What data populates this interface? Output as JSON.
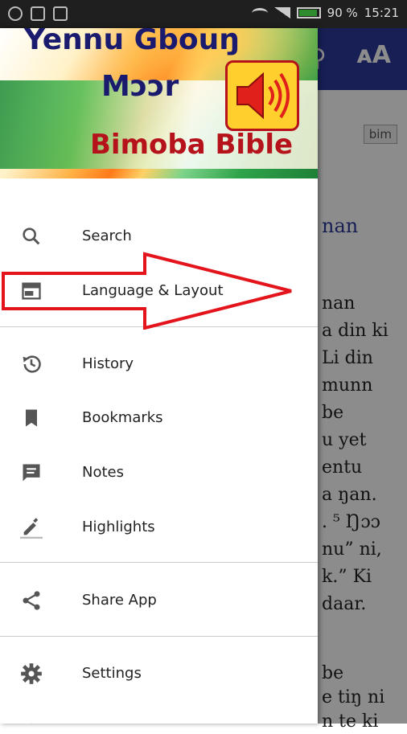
{
  "status_bar": {
    "battery": "90 %",
    "time": "15:21"
  },
  "app": {
    "aa_label": "ᴀA",
    "bim_label": "bim",
    "heading": "nan",
    "body_lines": [
      "nan",
      "a din ki",
      "Li din",
      "munn",
      "be",
      "u yet",
      "entu",
      "a ŋan.",
      ". ⁵ Ŋɔɔ",
      "nu” ni,",
      "k.” Ki",
      "daar."
    ],
    "body_lines2": [
      "be",
      "e tiŋ ni",
      "n te ki"
    ]
  },
  "banner": {
    "line1": "Yennu Gbouŋ",
    "line2": "Mɔɔr",
    "line3": "Bimoba Bible",
    "speaker_icon": "speaker-icon"
  },
  "menu": {
    "items": [
      {
        "label": "Search",
        "icon": "search-icon"
      },
      {
        "label": "Language & Layout",
        "icon": "layout-icon"
      },
      {
        "label": "History",
        "icon": "history-icon"
      },
      {
        "label": "Bookmarks",
        "icon": "bookmark-icon"
      },
      {
        "label": "Notes",
        "icon": "notes-icon"
      },
      {
        "label": "Highlights",
        "icon": "highlight-icon"
      },
      {
        "label": "Share App",
        "icon": "share-icon"
      },
      {
        "label": "Settings",
        "icon": "gear-icon"
      }
    ]
  },
  "colors": {
    "accent": "#2b3a9b",
    "annotation": "#e3141b"
  }
}
